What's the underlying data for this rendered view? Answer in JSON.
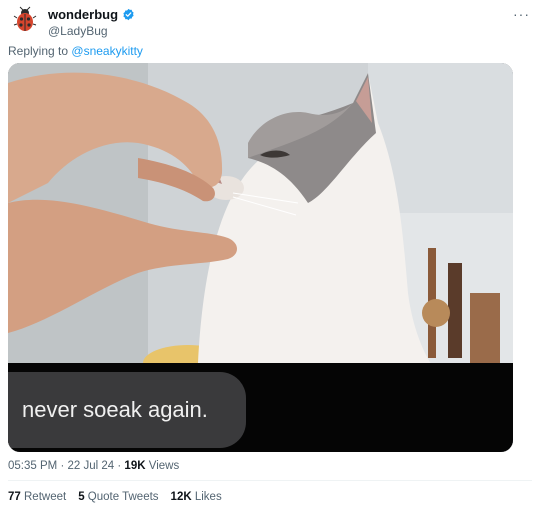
{
  "author": {
    "display_name": "wonderbug",
    "handle": "@LadyBug",
    "avatar_icon": "ladybug-icon",
    "verified": true
  },
  "menu_icon": "more-horizontal-icon",
  "more_glyph": "···",
  "reply": {
    "prefix": "Replying to",
    "to": "@sneakykitty"
  },
  "media": {
    "caption": "never soeak again."
  },
  "meta": {
    "time": "05:35 PM",
    "separator": "·",
    "date": "22 Jul 24",
    "views_count": "19K",
    "views_label": "Views"
  },
  "stats": {
    "retweets_count": "77",
    "retweets_label": "Retweet",
    "quotes_count": "5",
    "quotes_label": "Quote Tweets",
    "likes_count": "12K",
    "likes_label": "Likes"
  },
  "colors": {
    "accent": "#1d9bf0",
    "secondary_text": "#536471",
    "primary_text": "#0f1419"
  }
}
